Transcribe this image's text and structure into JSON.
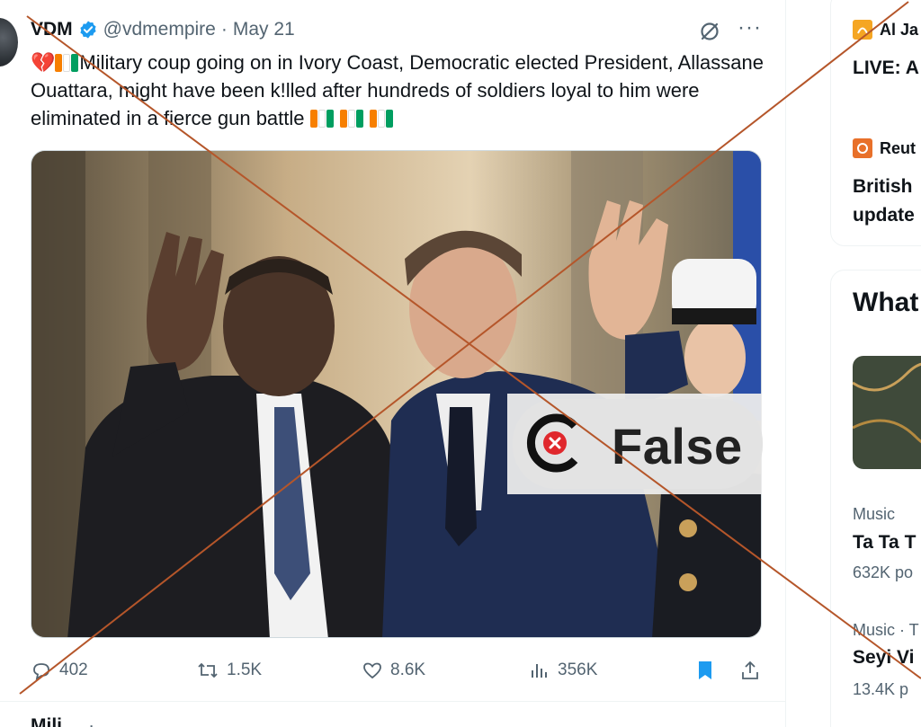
{
  "tweet": {
    "author_name": "VDM",
    "handle": "@vdmempire",
    "separator": "·",
    "date": "May 21",
    "more": "···",
    "text_part1": "Military coup going on in Ivory Coast, Democratic elected President, Allassane Ouattara, might have been k!lled after hundreds of soldiers loyal to him were eliminated in a fierce gun battle",
    "photo_alt_icon": "photo-of-two-leaders-waving",
    "fact_check_label": "False",
    "stats": {
      "replies": "402",
      "reposts": "1.5K",
      "likes": "8.6K",
      "views": "356K"
    }
  },
  "next_tweet": {
    "name": "Mili",
    "rest": "... ·..."
  },
  "sidebar": {
    "news": [
      {
        "source": "Al Ja",
        "headline": "LIVE: A"
      },
      {
        "source": "Reut",
        "headline_line1": "British",
        "headline_line2": "update"
      }
    ],
    "whats_title": "What",
    "trends": [
      {
        "category": "Music",
        "title": "Ta Ta T",
        "posts": "632K po"
      },
      {
        "category": "Music · T",
        "title": "Seyi Vi",
        "posts": "13.4K p"
      }
    ]
  },
  "colors": {
    "cross_line": "#b5562a",
    "verified": "#1d9bf0",
    "aljazeera": "#f5a623",
    "reuters": "#e8702a",
    "bookmark": "#1d9bf0",
    "false_logo_red": "#e0282d"
  }
}
